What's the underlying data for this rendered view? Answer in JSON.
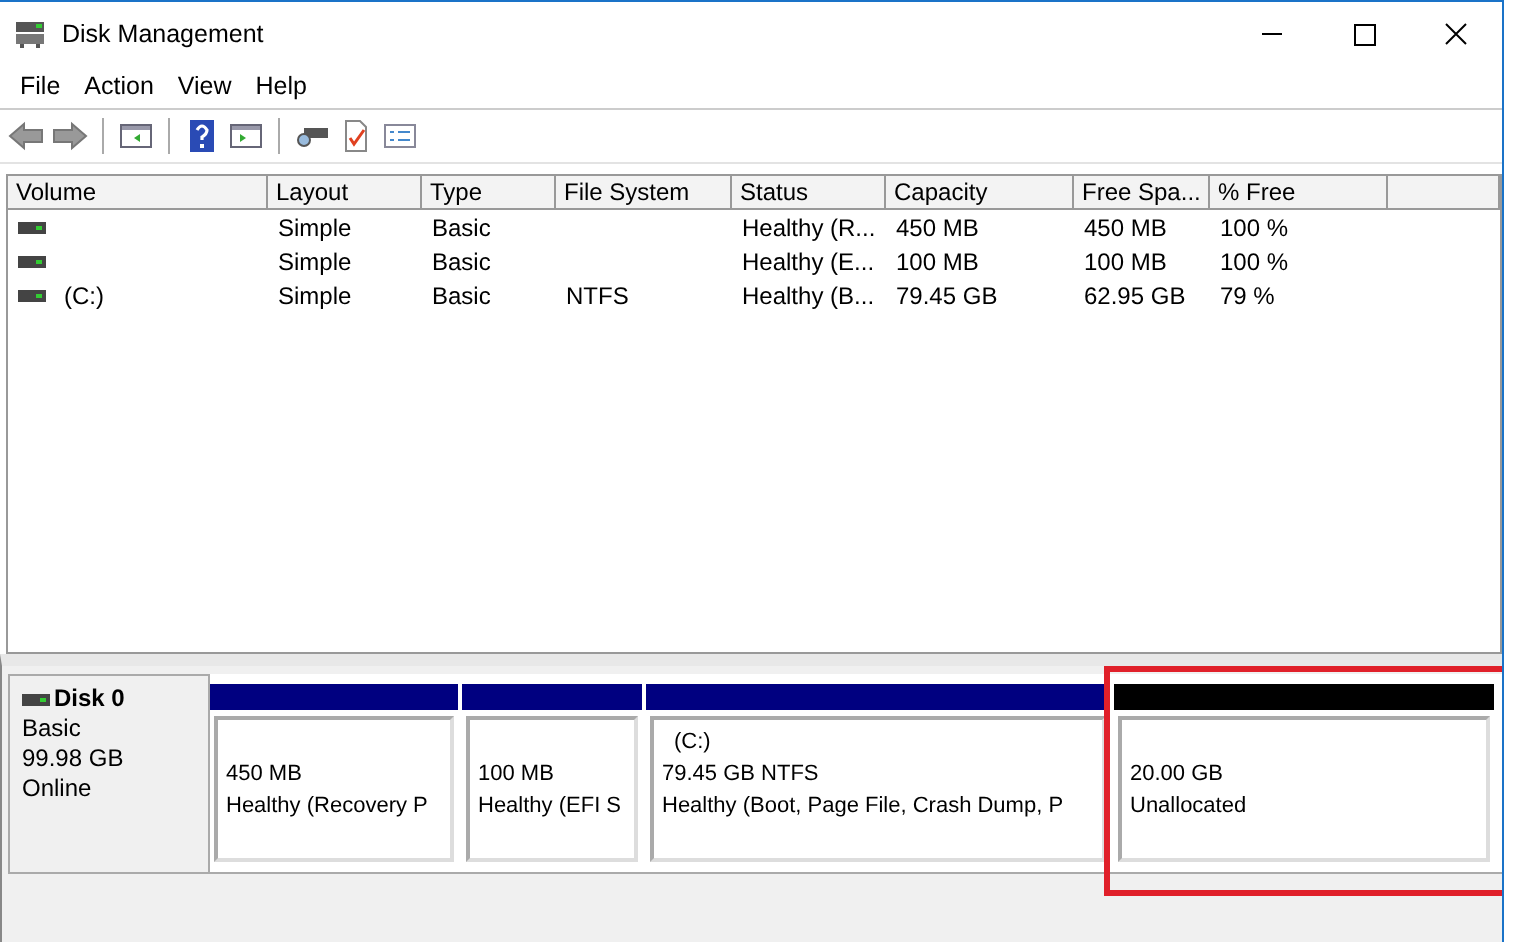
{
  "window": {
    "title": "Disk Management"
  },
  "menu": [
    "File",
    "Action",
    "View",
    "Help"
  ],
  "table": {
    "columns": [
      "Volume",
      "Layout",
      "Type",
      "File System",
      "Status",
      "Capacity",
      "Free Spa...",
      "% Free"
    ],
    "rows": [
      [
        "",
        "Simple",
        "Basic",
        "",
        "Healthy (R...",
        "450 MB",
        "450 MB",
        "100 %"
      ],
      [
        "",
        "Simple",
        "Basic",
        "",
        "Healthy (E...",
        "100 MB",
        "100 MB",
        "100 %"
      ],
      [
        "(C:)",
        "Simple",
        "Basic",
        "NTFS",
        "Healthy (B...",
        "79.45 GB",
        "62.95 GB",
        "79 %"
      ]
    ]
  },
  "disk": {
    "name": "Disk 0",
    "type": "Basic",
    "size": "99.98 GB",
    "status": "Online",
    "partitions": [
      {
        "kind": "primary",
        "size": "450 MB",
        "status": "Healthy (Recovery P",
        "highlighted": false
      },
      {
        "kind": "primary",
        "size": "100 MB",
        "status": "Healthy (EFI S",
        "highlighted": false
      },
      {
        "kind": "primary",
        "label": "(C:)",
        "size": "79.45 GB NTFS",
        "status": "Healthy (Boot, Page File, Crash Dump, P",
        "highlighted": false
      },
      {
        "kind": "unallocated",
        "size": "20.00 GB",
        "status": "Unallocated",
        "highlighted": true
      }
    ]
  }
}
